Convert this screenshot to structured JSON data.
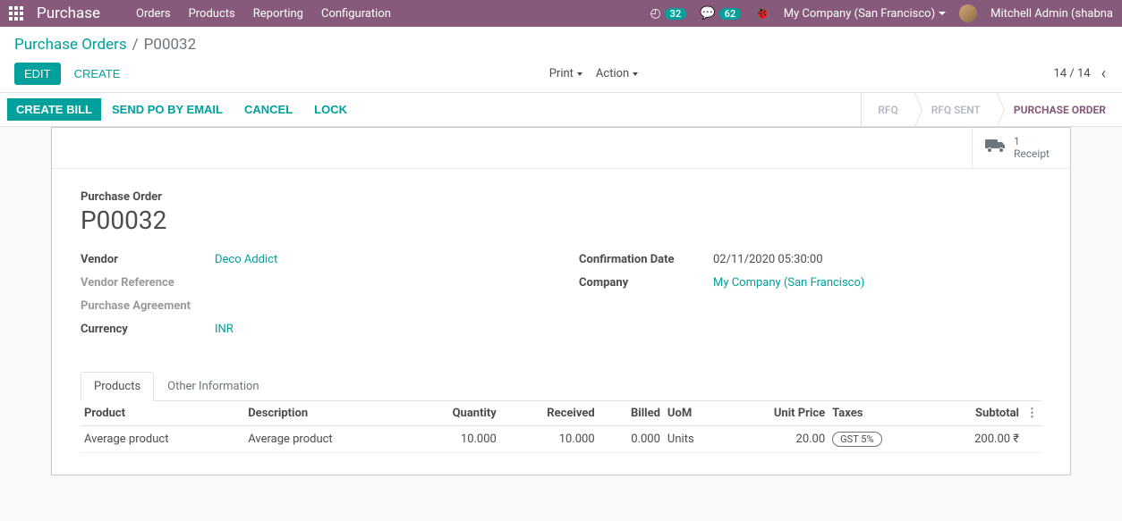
{
  "topbar": {
    "app_name": "Purchase",
    "menu": [
      "Orders",
      "Products",
      "Reporting",
      "Configuration"
    ],
    "clock_badge": "32",
    "chat_badge": "62",
    "company": "My Company (San Francisco)",
    "user": "Mitchell Admin (shabna"
  },
  "breadcrumb": {
    "parent": "Purchase Orders",
    "current": "P00032"
  },
  "control": {
    "edit": "EDIT",
    "create": "CREATE",
    "print": "Print",
    "action": "Action",
    "pager": "14 / 14"
  },
  "statusbar": {
    "create_bill": "CREATE BILL",
    "send_po": "SEND PO BY EMAIL",
    "cancel": "CANCEL",
    "lock": "LOCK",
    "steps": [
      "RFQ",
      "RFQ SENT",
      "PURCHASE ORDER"
    ]
  },
  "stat": {
    "count": "1",
    "label": "Receipt"
  },
  "form": {
    "title_label": "Purchase Order",
    "title": "P00032",
    "left": {
      "vendor_label": "Vendor",
      "vendor": "Deco Addict",
      "vendor_ref_label": "Vendor Reference",
      "purchase_agreement_label": "Purchase Agreement",
      "currency_label": "Currency",
      "currency": "INR"
    },
    "right": {
      "confirm_date_label": "Confirmation Date",
      "confirm_date": "02/11/2020 05:30:00",
      "company_label": "Company",
      "company": "My Company (San Francisco)"
    }
  },
  "tabs": {
    "products": "Products",
    "other": "Other Information"
  },
  "table": {
    "headers": {
      "product": "Product",
      "description": "Description",
      "quantity": "Quantity",
      "received": "Received",
      "billed": "Billed",
      "uom": "UoM",
      "unit_price": "Unit Price",
      "taxes": "Taxes",
      "subtotal": "Subtotal"
    },
    "rows": [
      {
        "product": "Average product",
        "description": "Average product",
        "quantity": "10.000",
        "received": "10.000",
        "billed": "0.000",
        "uom": "Units",
        "unit_price": "20.00",
        "taxes": "GST 5%",
        "subtotal": "200.00 ₹"
      }
    ]
  }
}
